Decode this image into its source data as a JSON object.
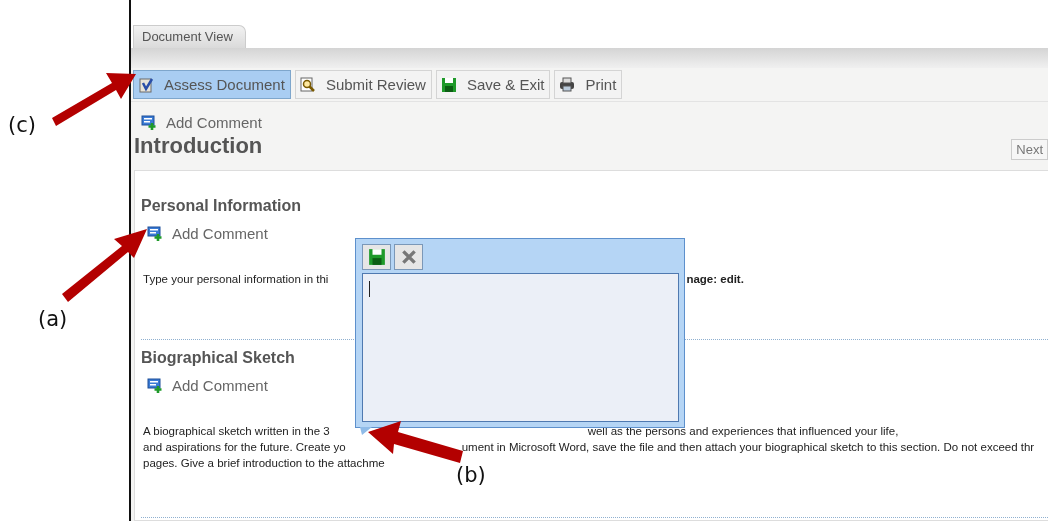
{
  "annotations": [
    {
      "label": "(c)"
    },
    {
      "label": "(a)"
    },
    {
      "label": "(b)"
    }
  ],
  "tabs": [
    {
      "label": "Document View",
      "selected": true
    }
  ],
  "toolbar": [
    {
      "label": "Assess Document",
      "kind": "assess",
      "selected": true
    },
    {
      "label": "Submit Review",
      "kind": "review",
      "selected": false
    },
    {
      "label": "Save & Exit",
      "kind": "save",
      "selected": false
    },
    {
      "label": "Print",
      "kind": "print",
      "selected": false
    }
  ],
  "add_comment": "Add Comment",
  "title": "Introduction",
  "next_button": "Next",
  "sections": [
    {
      "heading": "Personal Information",
      "add_comment": "Add Comment",
      "lines": [
        [
          {
            "text": "Type  your personal information in thi",
            "bold": false
          },
          {
            "text": "nage:  edit.",
            "bold": true
          }
        ]
      ]
    },
    {
      "heading": "Biographical Sketch",
      "add_comment": "Add Comment",
      "lines": [
        [
          {
            "text": "A biographical sketch written in the 3",
            "bold": false
          },
          {
            "text": "well as the persons and experiences that influenced your life,",
            "bold": false
          }
        ],
        [
          {
            "text": "and aspirations for the future.  Create yo",
            "bold": false
          },
          {
            "text": "ument in Microsoft Word, save the file and then attach your biographical sketch to this section.  Do not exceed thr",
            "bold": false
          }
        ],
        [
          {
            "text": "pages. Give a brief introduction to the attachme",
            "bold": false
          }
        ]
      ]
    }
  ],
  "comment_popup": {
    "buttons": [
      {
        "kind": "save"
      },
      {
        "kind": "close"
      }
    ]
  }
}
